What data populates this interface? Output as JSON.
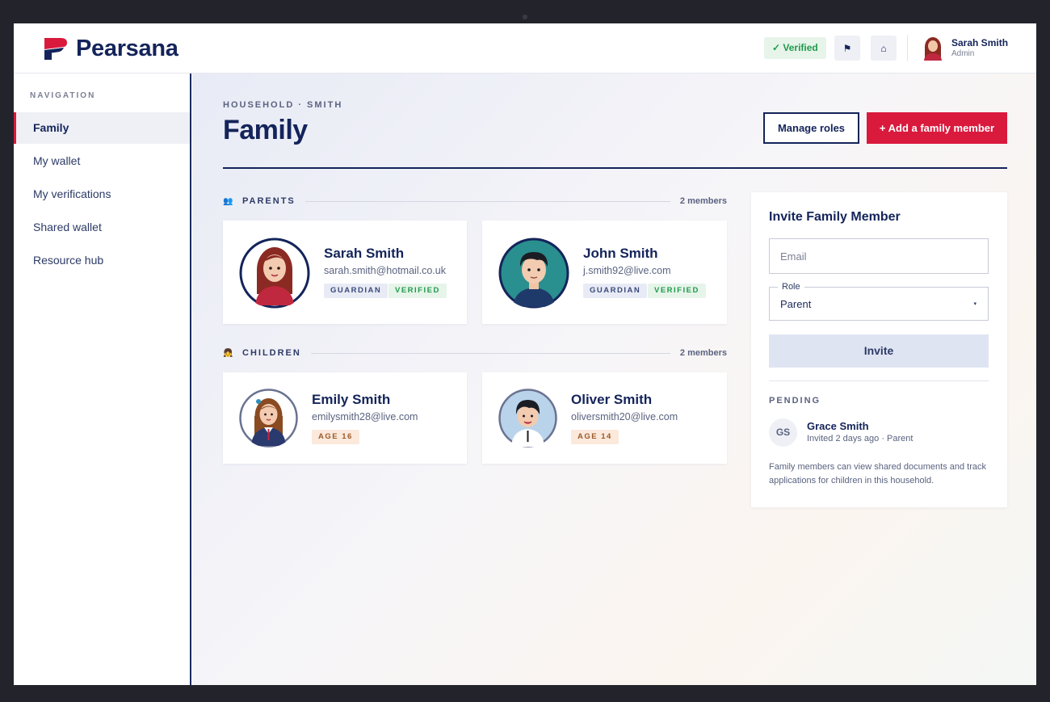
{
  "app": {
    "name": "Pearsana"
  },
  "header": {
    "verified_label": "✓ Verified",
    "flag_icon": "⚑",
    "home_icon": "⌂",
    "user": {
      "name": "Sarah Smith",
      "role": "Admin"
    }
  },
  "sidebar": {
    "heading": "NAVIGATION",
    "items": [
      {
        "label": "Family",
        "active": true
      },
      {
        "label": "My wallet"
      },
      {
        "label": "My verifications"
      },
      {
        "label": "Shared wallet"
      },
      {
        "label": "Resource hub"
      }
    ]
  },
  "page": {
    "breadcrumb": "HOUSEHOLD · SMITH",
    "title": "Family",
    "manage_roles_label": "Manage roles",
    "add_member_label": "+ Add a family member"
  },
  "sections": {
    "parents": {
      "icon": "👥",
      "label": "PARENTS",
      "count": "2 members",
      "members": [
        {
          "name": "Sarah Smith",
          "email": "sarah.smith@hotmail.co.uk",
          "tags": [
            "GUARDIAN",
            "VERIFIED"
          ]
        },
        {
          "name": "John Smith",
          "email": "j.smith92@live.com",
          "tags": [
            "GUARDIAN",
            "VERIFIED"
          ]
        }
      ]
    },
    "children": {
      "icon": "👧",
      "label": "CHILDREN",
      "count": "2 members",
      "members": [
        {
          "name": "Emily Smith",
          "email": "emilysmith28@live.com",
          "tags": [
            "AGE 16"
          ]
        },
        {
          "name": "Oliver Smith",
          "email": "oliversmith20@live.com",
          "tags": [
            "AGE 14"
          ]
        }
      ]
    }
  },
  "invite": {
    "title": "Invite Family Member",
    "email_placeholder": "Email",
    "role_label": "Role",
    "role_value": "Parent",
    "caret": "▾",
    "button_label": "Invite",
    "pending_label": "PENDING",
    "pending": [
      {
        "initials": "GS",
        "name": "Grace Smith",
        "meta": "Invited 2 days ago · Parent"
      }
    ],
    "note": "Family members can view shared documents and track applications for children in this household."
  },
  "colors": {
    "brand_navy": "#14245a",
    "brand_red": "#d91a3d",
    "verified_green": "#1f9a4a"
  }
}
